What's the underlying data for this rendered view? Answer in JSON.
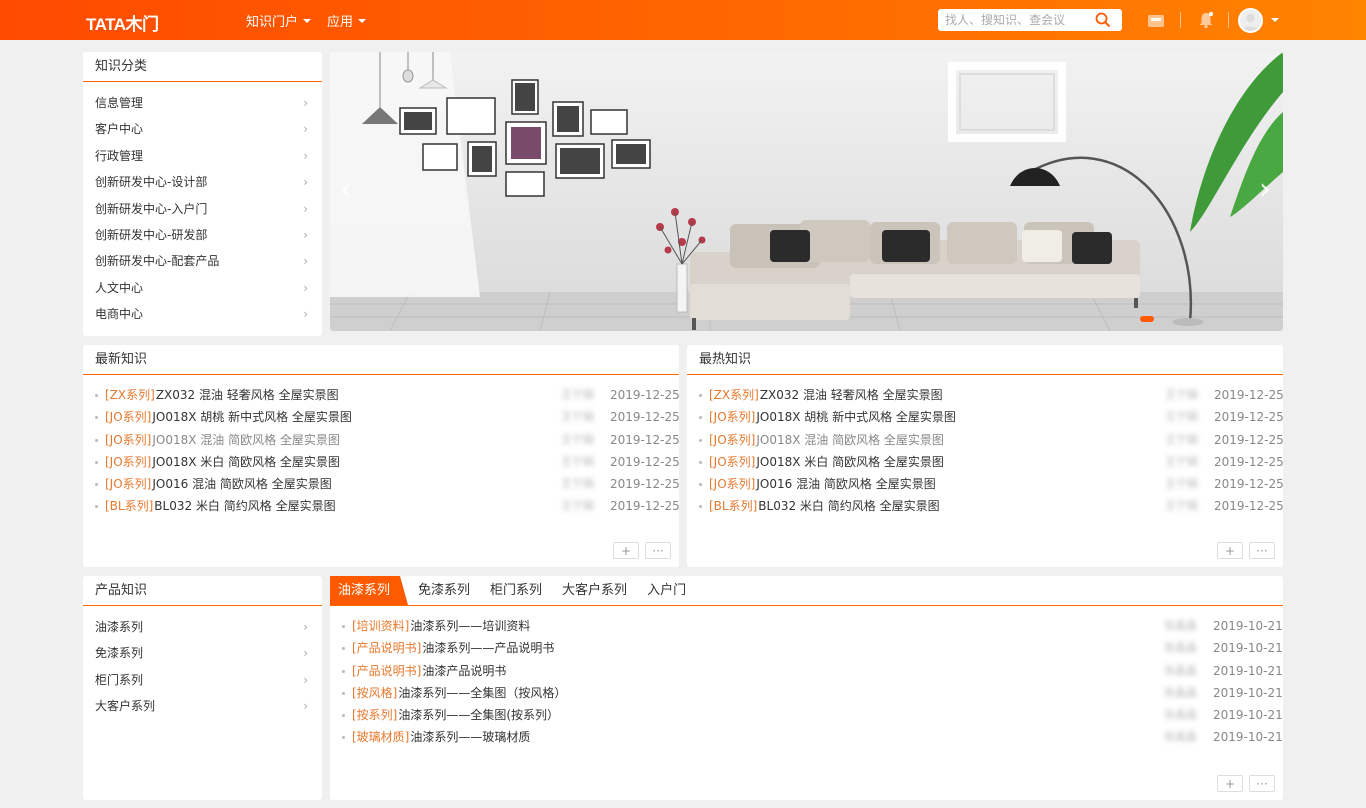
{
  "header": {
    "logo": "TATA木门",
    "nav": [
      {
        "label": "知识门户"
      },
      {
        "label": "应用"
      }
    ],
    "search": {
      "placeholder": "找人、搜知识、查会议"
    }
  },
  "categories": {
    "title": "知识分类",
    "items": [
      "信息管理",
      "客户中心",
      "行政管理",
      "创新研发中心-设计部",
      "创新研发中心-入户门",
      "创新研发中心-研发部",
      "创新研发中心-配套产品",
      "人文中心",
      "电商中心"
    ]
  },
  "latest": {
    "title": "最新知识",
    "items": [
      {
        "tag": "[ZX系列]",
        "title": "ZX032 混油 轻奢风格 全屋实景图",
        "author": "王宁娟",
        "date": "2019-12-25",
        "read": false
      },
      {
        "tag": "[JO系列]",
        "title": "JO018X 胡桃 新中式风格 全屋实景图",
        "author": "王宁娟",
        "date": "2019-12-25",
        "read": false
      },
      {
        "tag": "[JO系列]",
        "title": "JO018X 混油 简欧风格 全屋实景图",
        "author": "王宁娟",
        "date": "2019-12-25",
        "read": true
      },
      {
        "tag": "[JO系列]",
        "title": "JO018X 米白 简欧风格 全屋实景图",
        "author": "王宁娟",
        "date": "2019-12-25",
        "read": false
      },
      {
        "tag": "[JO系列]",
        "title": "JO016 混油 简欧风格 全屋实景图",
        "author": "王宁娟",
        "date": "2019-12-25",
        "read": false
      },
      {
        "tag": "[BL系列]",
        "title": "BL032 米白 简约风格 全屋实景图",
        "author": "王宁娟",
        "date": "2019-12-25",
        "read": false
      }
    ]
  },
  "hottest": {
    "title": "最热知识",
    "items": [
      {
        "tag": "[ZX系列]",
        "title": "ZX032 混油 轻奢风格 全屋实景图",
        "author": "王宁娟",
        "date": "2019-12-25",
        "read": false
      },
      {
        "tag": "[JO系列]",
        "title": "JO018X 胡桃 新中式风格 全屋实景图",
        "author": "王宁娟",
        "date": "2019-12-25",
        "read": false
      },
      {
        "tag": "[JO系列]",
        "title": "JO018X 混油 简欧风格 全屋实景图",
        "author": "王宁娟",
        "date": "2019-12-25",
        "read": true
      },
      {
        "tag": "[JO系列]",
        "title": "JO018X 米白 简欧风格 全屋实景图",
        "author": "王宁娟",
        "date": "2019-12-25",
        "read": false
      },
      {
        "tag": "[JO系列]",
        "title": "JO016 混油 简欧风格 全屋实景图",
        "author": "王宁娟",
        "date": "2019-12-25",
        "read": false
      },
      {
        "tag": "[BL系列]",
        "title": "BL032 米白 简约风格 全屋实景图",
        "author": "王宁娟",
        "date": "2019-12-25",
        "read": false
      }
    ]
  },
  "products": {
    "title": "产品知识",
    "items": [
      "油漆系列",
      "免漆系列",
      "柜门系列",
      "大客户系列"
    ]
  },
  "tabs": {
    "items": [
      "油漆系列",
      "免漆系列",
      "柜门系列",
      "大客户系列",
      "入户门"
    ],
    "active": 0,
    "list": [
      {
        "tag": "[培训资料]",
        "title": "油漆系列——培训资料",
        "author": "张晶晶",
        "date": "2019-10-21"
      },
      {
        "tag": "[产品说明书]",
        "title": "油漆系列——产品说明书",
        "author": "张晶晶",
        "date": "2019-10-21"
      },
      {
        "tag": "[产品说明书]",
        "title": "油漆产品说明书",
        "author": "张晶晶",
        "date": "2019-10-21"
      },
      {
        "tag": "[按风格]",
        "title": "油漆系列——全集图（按风格）",
        "author": "张晶晶",
        "date": "2019-10-21"
      },
      {
        "tag": "[按系列]",
        "title": "油漆系列——全集图(按系列）",
        "author": "张晶晶",
        "date": "2019-10-21"
      },
      {
        "tag": "[玻璃材质]",
        "title": "油漆系列——玻璃材质",
        "author": "张晶晶",
        "date": "2019-10-21"
      }
    ]
  },
  "footer_buttons": {
    "add": "+",
    "more": "···"
  },
  "colors": {
    "brand": "#ff5a00",
    "tag": "#e8782c"
  }
}
